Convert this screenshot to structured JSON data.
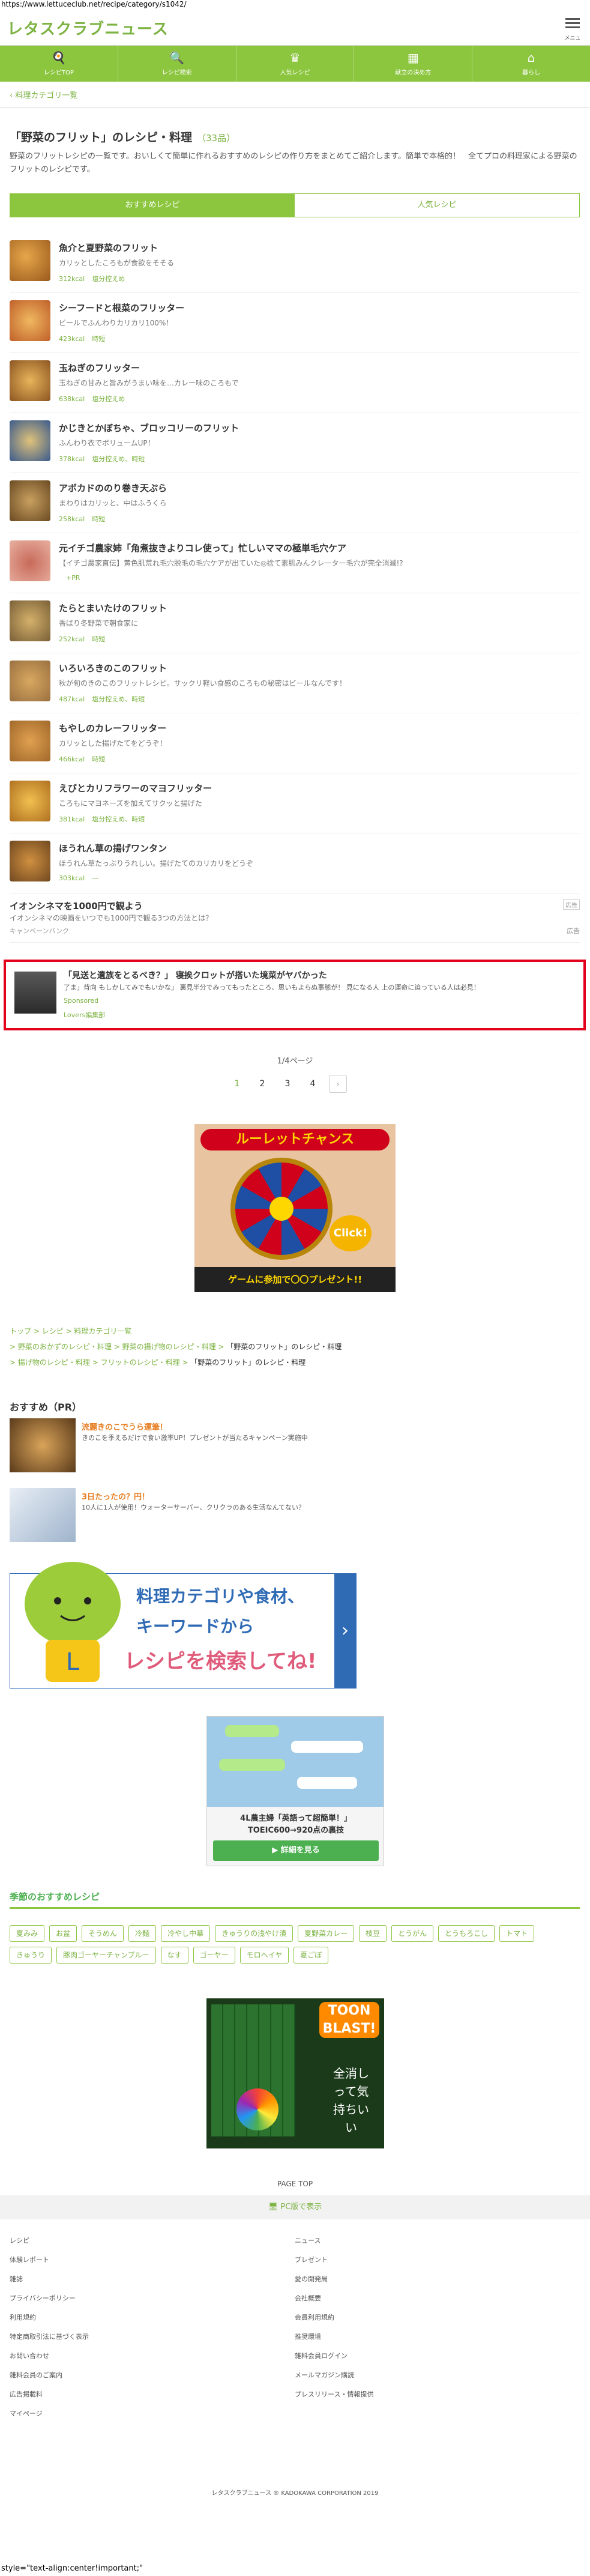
{
  "url": "https://www.lettuceclub.net/recipe/category/s1042/",
  "site": {
    "logo": "レタスクラブニュース",
    "menu_label": "メニュー"
  },
  "nav": [
    {
      "label": "レシピTOP",
      "icon": "🍳"
    },
    {
      "label": "レシピ検索",
      "icon": "🔍"
    },
    {
      "label": "人気レシピ",
      "icon": "♛"
    },
    {
      "label": "献立の決め方",
      "icon": "▦"
    },
    {
      "label": "暮らし",
      "icon": "⌂"
    }
  ],
  "back_link": "‹ 料理カテゴリ一覧",
  "page": {
    "title": "「野菜のフリット」のレシピ・料理",
    "count": "（33品）",
    "description": "野菜のフリットレシピの一覧です。おいしくて簡単に作れるおすすめのレシピの作り方をまとめてご紹介します。簡単で本格的！　全てプロの料理家による野菜のフリットのレシピです。"
  },
  "tabs": {
    "recommended": "おすすめレシピ",
    "popular": "人気レシピ"
  },
  "recipes": [
    {
      "title": "魚介と夏野菜のフリット",
      "sub": "カリッとしたころもが食欲をそそる",
      "kcal": "312kcal",
      "tag": "塩分控えめ"
    },
    {
      "title": "シーフードと根菜のフリッター",
      "sub": "ビールでふんわりカリカリ100%！",
      "kcal": "423kcal",
      "tag": "時短"
    },
    {
      "title": "玉ねぎのフリッター",
      "sub": "玉ねぎの甘みと旨みがうまい味を…カレー味のころもで",
      "kcal": "638kcal",
      "tag": "塩分控えめ"
    },
    {
      "title": "かじきとかぼちゃ、ブロッコリーのフリット",
      "sub": "ふんわり衣でボリュームUP！",
      "kcal": "378kcal",
      "tag": "塩分控えめ、時短"
    },
    {
      "title": "アボカドののり巻き天ぷら",
      "sub": "まわりはカリッと、中はふうくら",
      "kcal": "258kcal",
      "tag": "時短"
    },
    {
      "title": "元イチゴ農家姉「角煮抜きよりコレ使って」忙しいママの極単毛穴ケア",
      "sub": "【イチゴ農家直伝】黄色肌荒れ毛穴脱毛の毛穴ケアが出ていた◎捨て素肌みんクレーター毛穴が完全消滅!?",
      "kcal": "",
      "tag": "+PR"
    },
    {
      "title": "たらとまいたけのフリット",
      "sub": "香ばり冬野菜で朝食家に",
      "kcal": "252kcal",
      "tag": "時短"
    },
    {
      "title": "いろいろきのこのフリット",
      "sub": "秋が旬のきのこのフリットレシピ。サックリ軽い食感のころもの秘密はビールなんです！",
      "kcal": "487kcal",
      "tag": "塩分控えめ、時短"
    },
    {
      "title": "もやしのカレーフリッター",
      "sub": "カリッとした揚げたてをどうぞ！",
      "kcal": "466kcal",
      "tag": "時短"
    },
    {
      "title": "えびとカリフラワーのマヨフリッター",
      "sub": "ころもにマヨネーズを加えてサクッと揚げた",
      "kcal": "381kcal",
      "tag": "塩分控えめ、時短"
    },
    {
      "title": "ほうれん草の揚げワンタン",
      "sub": "ほうれん草たっぷりうれしい。揚げたてのカリカリをどうぞ",
      "kcal": "303kcal",
      "tag": "―"
    }
  ],
  "ad_row": {
    "title": "イオンシネマを1000円で観よう",
    "sub": "イオンシネマの映画をいつでも1000円で観る3つの方法とは？",
    "sponsor": "キャンペーンバンク",
    "tag": "広告",
    "label": "広告"
  },
  "highlight": {
    "title": "「見送と遺族をとるべき？」 寝挨クロットが搭いた境菜がヤバかった",
    "sub": "了ま」背向 もしかしてみでもいかな」 裏見半分でみってもったところ、思いもよらぬ事態が！ 見になる人 上の運命に迫っている人は必見！",
    "sponsored": "Sponsored",
    "source": "Lovers編集部"
  },
  "pagination": {
    "count": "1/4ページ",
    "pages": [
      "1",
      "2",
      "3",
      "4"
    ],
    "next": "›"
  },
  "roulette": {
    "head": "ルーレットチャンス",
    "click": "Click!",
    "foot": "ゲームに参加で〇〇プレゼント!!"
  },
  "breadcrumbs": {
    "line1": [
      "トップ",
      "レシピ",
      "料理カテゴリ一覧"
    ],
    "line2": [
      "野菜のおかずのレシピ・料理",
      "野菜の揚げ物のレシピ・料理",
      "「野菜のフリット」のレシピ・料理"
    ],
    "line3": [
      "揚げ物のレシピ・料理",
      "フリットのレシピ・料理",
      "「野菜のフリット」のレシピ・料理"
    ]
  },
  "pr": {
    "title": "おすすめ（PR）",
    "items": [
      {
        "title": "流麗きのこでうら運筆！",
        "sub": "きのこを季えるだけで食い激率UP！プレゼントが当たるキャンペーン実施中"
      },
      {
        "title": "3日たったの？円！",
        "sub": "10人に1人が使用！ウォーターサーバー、クリクラのある生活なんてない？"
      }
    ]
  },
  "search_banner": {
    "line1": "料理カテゴリや食材、",
    "line2": "キーワードから",
    "line3": "レシピを検索してね!"
  },
  "line_ad": {
    "title": "4L農主婦「英語って超簡単！」",
    "title2": "TOEIC600→920点の裏技",
    "button": "▶ 詳細を見る"
  },
  "season": {
    "title": "季節のおすすめレシピ",
    "tags": [
      "夏みみ",
      "お盆",
      "そうめん",
      "冷麺",
      "冷やし中華",
      "きゅうりの浅やけ漬",
      "夏野菜カレー",
      "枝豆",
      "とうがん",
      "とうもろこし",
      "トマト",
      "きゅうり",
      "豚肉ゴーヤーチャンプルー",
      "なす",
      "ゴーヤー",
      "モロヘイヤ",
      "夏ごぼ"
    ]
  },
  "toon": {
    "logo": "TOON BLAST!",
    "text": "全消しって気持ちいい"
  },
  "page_top": "PAGE TOP",
  "pc_view": "🖥 PC版で表示",
  "footer_links": [
    "レシピ",
    "ニュース",
    "体験レポート",
    "プレゼント",
    "雑誌",
    "愛の開発局",
    "プライバシーポリシー",
    "会社概要",
    "利用規約",
    "会員利用規約",
    "特定商取引法に基づく表示",
    "推奨環境",
    "お問い合わせ",
    "雑料会員ログイン",
    "雑料会員のご案内",
    "メールマガジン購読",
    "広告掲載料",
    "プレスリリース・情報提供",
    "マイページ"
  ],
  "copyright": "レタスクラブニュース ® KADOKAWA CORPORATION 2019",
  "bottom_text": "style=\"text-align:center!important;\""
}
